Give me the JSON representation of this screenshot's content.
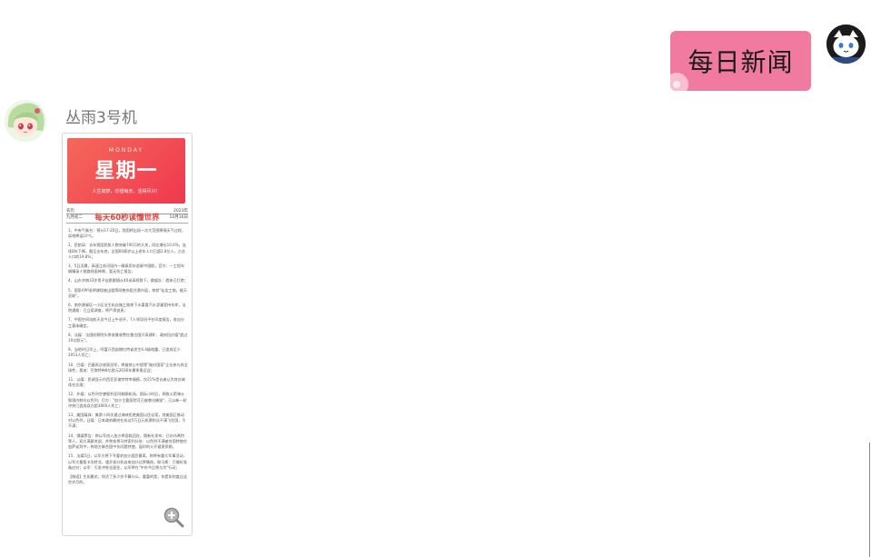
{
  "outgoing": {
    "text": "每日新闻"
  },
  "incoming": {
    "sender": "丛雨3号机",
    "card": {
      "day_en": "MONDAY",
      "day_cn": "星期一",
      "slogan": "人生如梦，珍惜每天，活得尽兴！",
      "meta_left_top": "农历",
      "meta_right_top": "2023年",
      "meta_left_bottom": "九月初二",
      "meta_right_bottom": "10月16日",
      "headline": "每天60秒读懂世界",
      "items": [
        "1、中央气象台：预计17-20日，我国将出现一次大范围寒潮天气过程，局地降温10℃。",
        "2、民航局：去年我国民航人数突破700万的大关，同比增长10.6%，连续8年下降。截至去年底，全国60周岁以上老年人口已超2.8亿人，占总人口的19.8%；",
        "3、5日凌晨，高速江苏河段内一辆乘用车追尾中国航，官方：一工程车辆撞录人铁路线面神侧，暂无伤亡报告；",
        "4、山东济南33岁男子自愿跟随从40米高桥跌下，救援队：遗体已打捞；",
        "5、国家APP说明课程被出租等网售充租兑票内容，称其\"仙女工商，能天亚联\"。",
        "6、南京建邺区一小区业主私自施工致地下水渠冒汽水浸漫室持车库，法院通报：已立案调查，将严肃追责；",
        "7、中国空间站航天员今日上午进开，7人领导班子在印度报告，各自分工基本确定。",
        "8、法媒：法国检察院头将收夏收费在雷古国开采建矿，政府回价值\"超过10亿欧元\"。",
        "9、当地时日早上，阿富汗西部赫拉特省发生6.4级地震，已造成至少2053人死亡；",
        "10、巴媒：巴塞再次收获冠军，将被禁止中国等\"暗对国家\"企业参与其全球性，奥迪：巴黎将带8亿欧元2036年夏季奥运会；",
        "11、以媒：民调显示约西亚亚坡宗特幸福感，仅21%受访者认为其应继续任总理；",
        "12、外媒：以色列空袭叙利亚阿勒颇机场，国际小时后，两枚火箭弹从叙境内射向以色列，巴方：\"加沙主要医院可已被袭击摧毁\"，已以新一轮冲突已造成双方超3800人死亡；",
        "13、美国媒体：美第十四次通过海峡拒绝美国以民议案，其美国正推动对以色列，日媒：日本政府最终在抗议5万日元机票和法不满飞往国，引不满；",
        "14、俄媒警告：称以军进入加沙将面临回应，俄新社发布：已向乌希特等人，双方满意关部，并称准将马特索利分处：以色列不满被合国特使在加萨谈判中，称地方联合国中东问题特使，届时的公开谴责伊朗。",
        "15、法媒5日，以军方将下令要求加沙居民撤离，称将有重大军事活动，以军大量租卡坦转北，谴开部分机自来加沙边界集结，联马斯：已做好准备应对；以军：引发冲突全面往，以军将在\"中东今后将与为\"行动；"
      ],
      "footer": "【微语】生如夏花，你活了多少岁不算什么，重要的是，你是如何度过这些岁月的。"
    }
  },
  "colors": {
    "bubble": "#f07aa0",
    "banner": "#f0384f",
    "headline": "#e0403a"
  },
  "icons": {
    "zoom": "zoom-in-icon",
    "me_avatar": "cat-avatar",
    "bot_avatar": "anime-girl-avatar"
  }
}
